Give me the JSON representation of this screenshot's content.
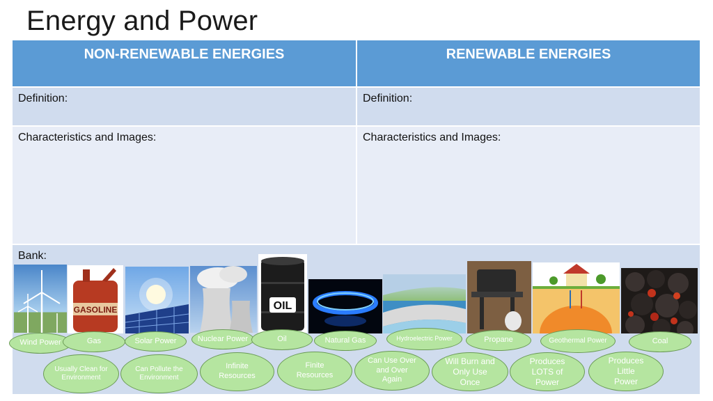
{
  "title": "Energy and Power",
  "headers": {
    "left": "NON-RENEWABLE ENERGIES",
    "right": "RENEWABLE ENERGIES"
  },
  "definition": {
    "left": "Definition:",
    "right": "Definition:"
  },
  "characteristics": {
    "left": "Characteristics and Images:",
    "right": "Characteristics and Images:"
  },
  "bank_label": "Bank:",
  "images": [
    "wind turbines",
    "gasoline can",
    "solar panel",
    "nuclear cooling towers",
    "oil barrel",
    "gas burner flame",
    "hydroelectric dam",
    "propane grill",
    "geothermal house",
    "coal"
  ],
  "ovals": {
    "wind": "Wind Power",
    "gas": "Gas",
    "solar": "Solar Power",
    "nuclear": "Nuclear Power",
    "oil": "Oil",
    "natural_gas": "Natural Gas",
    "hydro": "Hydroelectric Power",
    "propane": "Propane",
    "geothermal": "Geothermal Power",
    "coal": "Coal",
    "clean": "Usually Clean for Environment",
    "pollute": "Can Pollute the Environment",
    "infinite": "Infinite Resources",
    "finite": "Finite Resources",
    "reuse": "Can Use Over and Over Again",
    "once": "Will Burn and Only Use Once",
    "lots": "Produces LOTS of Power",
    "little": "Produces Little Power"
  }
}
